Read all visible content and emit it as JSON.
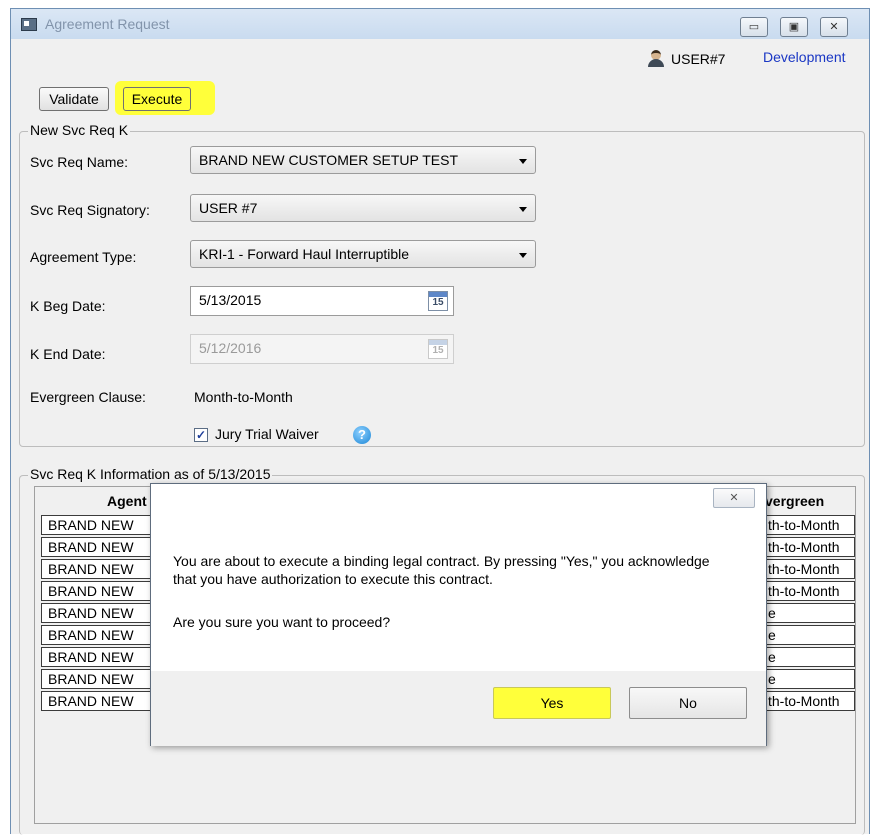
{
  "window": {
    "title": "Agreement Request",
    "minimize_glyph": "▭",
    "maximize_glyph": "▣",
    "close_glyph": "✕"
  },
  "header": {
    "user": "USER#7",
    "environment": "Development",
    "env_color": "#1a37c4"
  },
  "toolbar": {
    "validate_label": "Validate",
    "execute_label": "Execute",
    "highlight_color": "#ffff3a"
  },
  "form_group": {
    "title": "New Svc Req K",
    "svc_req_name_label": "Svc Req Name:",
    "svc_req_name_value": "BRAND NEW CUSTOMER SETUP TEST",
    "signatory_label": "Svc Req Signatory:",
    "signatory_value": "USER #7",
    "agreement_type_label": "Agreement Type:",
    "agreement_type_value": "KRI-1 - Forward Haul Interruptible",
    "k_beg_label": "K Beg Date:",
    "k_beg_value": "5/13/2015",
    "k_end_label": "K End Date:",
    "k_end_value": "5/12/2016",
    "calendar_day": "15",
    "evergreen_label": "Evergreen Clause:",
    "evergreen_value": "Month-to-Month",
    "jury_label": "Jury Trial Waiver",
    "jury_checked": "✓",
    "help_glyph": "?"
  },
  "info_group": {
    "title": "Svc Req K Information as of 5/13/2015",
    "col_agent": "Agent",
    "col_evergreen": "vergreen",
    "left_cells": [
      "BRAND NEW",
      "BRAND NEW",
      "BRAND NEW",
      "BRAND NEW",
      "BRAND NEW",
      "BRAND NEW",
      "BRAND NEW",
      "BRAND NEW",
      "BRAND NEW"
    ],
    "right_cells": [
      "th-to-Month",
      "th-to-Month",
      "th-to-Month",
      "th-to-Month",
      "e",
      "e",
      "e",
      "e",
      "th-to-Month"
    ]
  },
  "dialog": {
    "close_glyph": "✕",
    "message": "You are about to execute a binding legal contract. By pressing \"Yes,\" you acknowledge that you have authorization to execute this contract.",
    "question": "Are you sure you want to proceed?",
    "yes_label": "Yes",
    "no_label": "No"
  }
}
